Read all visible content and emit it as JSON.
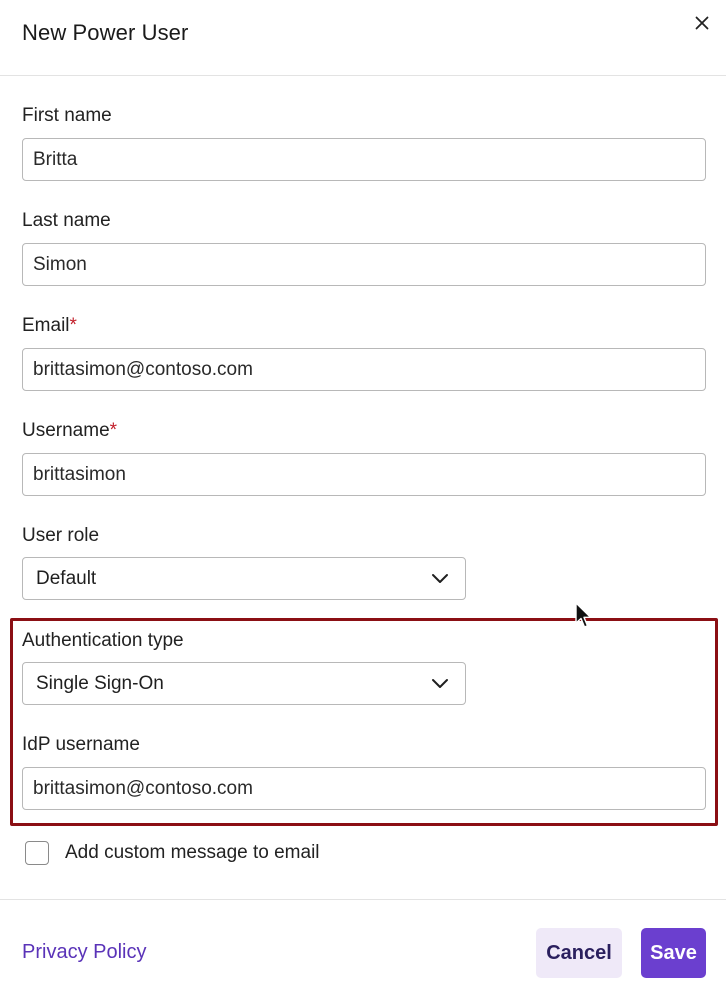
{
  "dialog": {
    "title": "New Power User",
    "close_icon": "close-icon"
  },
  "form": {
    "first_name": {
      "label": "First name",
      "value": "Britta"
    },
    "last_name": {
      "label": "Last name",
      "value": "Simon"
    },
    "email": {
      "label": "Email",
      "required_mark": "*",
      "value": "brittasimon@contoso.com"
    },
    "username": {
      "label": "Username",
      "required_mark": "*",
      "value": "brittasimon"
    },
    "user_role": {
      "label": "User role",
      "selected": "Default"
    },
    "authentication_type": {
      "label": "Authentication type",
      "selected": "Single Sign-On"
    },
    "idp_username": {
      "label": "IdP username",
      "value": "brittasimon@contoso.com"
    },
    "custom_message": {
      "label": "Add custom message to email",
      "checked": false
    }
  },
  "footer": {
    "privacy_link": "Privacy Policy",
    "cancel_label": "Cancel",
    "save_label": "Save"
  },
  "colors": {
    "accent": "#6b3fcf",
    "link": "#5a33b8",
    "required": "#c21f2a",
    "highlight_border": "#8b0f14",
    "cancel_bg": "#efe9f8"
  }
}
